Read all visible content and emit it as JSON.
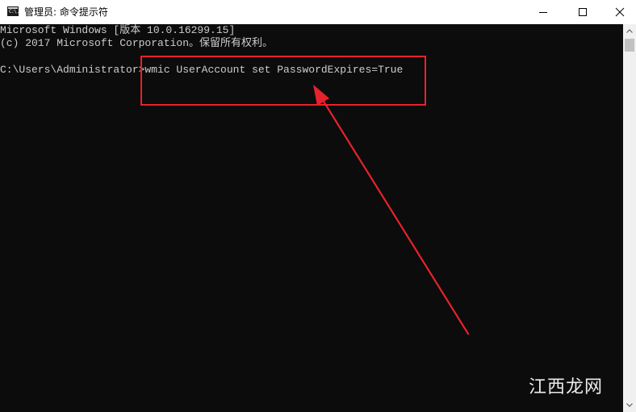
{
  "window": {
    "title": "管理员: 命令提示符",
    "app_icon_glyph": "C:\\.",
    "controls": [
      "minimize",
      "maximize",
      "close"
    ]
  },
  "console": {
    "lines": [
      "Microsoft Windows [版本 10.0.16299.15]",
      "(c) 2017 Microsoft Corporation。保留所有权利。",
      "",
      "C:\\Users\\Administrator>wmic UserAccount set PasswordExpires=True"
    ],
    "text_color": "#cccccc",
    "background": "#0c0c0c"
  },
  "annotation": {
    "color": "#e8222c"
  },
  "watermark": {
    "text": "江西龙网"
  }
}
